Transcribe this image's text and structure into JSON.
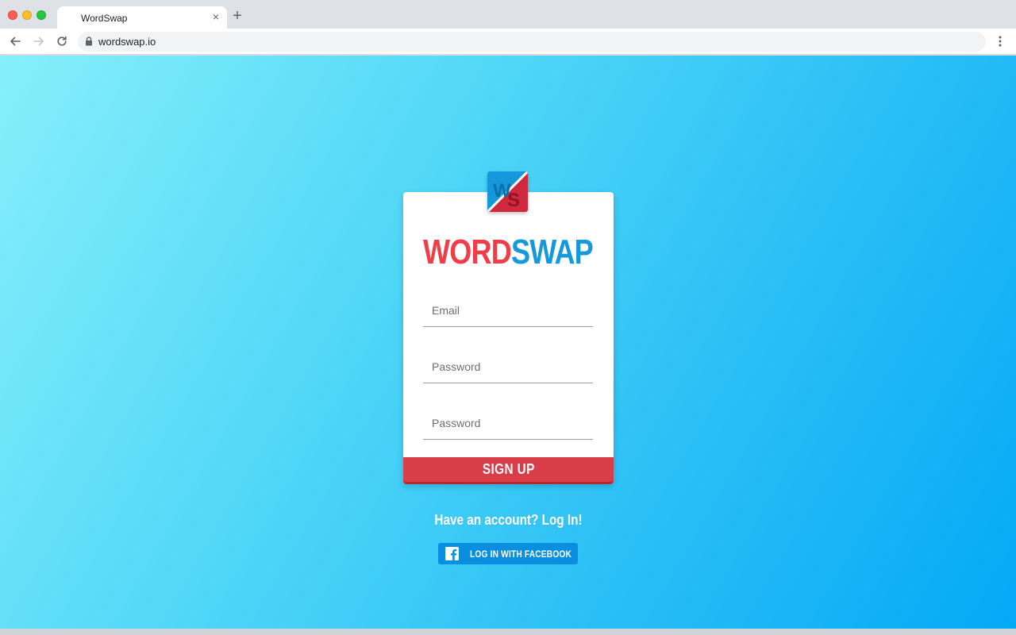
{
  "browser": {
    "tab_title": "WordSwap",
    "tab_close": "×",
    "new_tab": "+",
    "url": "wordswap.io"
  },
  "brand": {
    "word": "WORD",
    "swap": "SWAP",
    "icon_letters": "WS",
    "colors": {
      "red": "#ef3e4a",
      "blue": "#1598dc"
    }
  },
  "form": {
    "email_placeholder": "Email",
    "password_placeholder": "Password",
    "confirm_password_placeholder": "Password",
    "signup_label": "SIGN UP"
  },
  "login_link": "Have an account? Log In!",
  "facebook": {
    "label": "LOG IN WITH FACEBOOK",
    "icon": "facebook-icon"
  },
  "colors": {
    "gradient_start": "#86effb",
    "gradient_end": "#04a9f6",
    "signup_button": "#d83d48",
    "facebook_button": "#0a8fe0"
  }
}
